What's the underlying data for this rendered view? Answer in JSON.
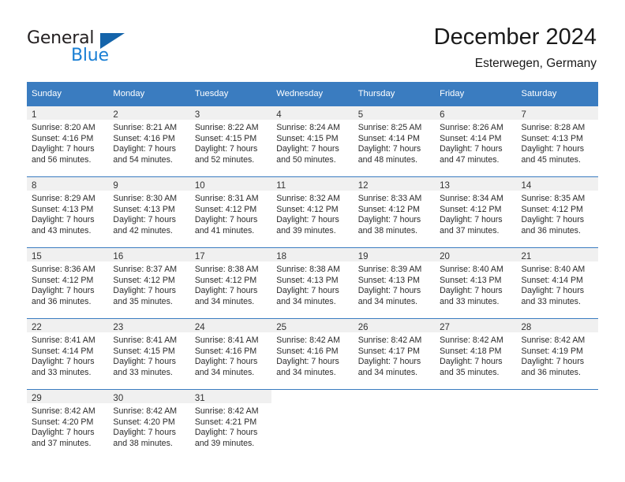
{
  "brand": {
    "line1": "General",
    "line2": "Blue",
    "triangle_color": "#1464aa"
  },
  "header": {
    "title": "December 2024",
    "subtitle": "Esterwegen, Germany"
  },
  "colors": {
    "header_blue": "#3a7cc0",
    "daynum_bg": "#f0f0f0",
    "brand_blue": "#1a7fd4"
  },
  "weekdays": [
    "Sunday",
    "Monday",
    "Tuesday",
    "Wednesday",
    "Thursday",
    "Friday",
    "Saturday"
  ],
  "weeks": [
    [
      {
        "day": "1",
        "sunrise": "Sunrise: 8:20 AM",
        "sunset": "Sunset: 4:16 PM",
        "daylight1": "Daylight: 7 hours",
        "daylight2": "and 56 minutes."
      },
      {
        "day": "2",
        "sunrise": "Sunrise: 8:21 AM",
        "sunset": "Sunset: 4:16 PM",
        "daylight1": "Daylight: 7 hours",
        "daylight2": "and 54 minutes."
      },
      {
        "day": "3",
        "sunrise": "Sunrise: 8:22 AM",
        "sunset": "Sunset: 4:15 PM",
        "daylight1": "Daylight: 7 hours",
        "daylight2": "and 52 minutes."
      },
      {
        "day": "4",
        "sunrise": "Sunrise: 8:24 AM",
        "sunset": "Sunset: 4:15 PM",
        "daylight1": "Daylight: 7 hours",
        "daylight2": "and 50 minutes."
      },
      {
        "day": "5",
        "sunrise": "Sunrise: 8:25 AM",
        "sunset": "Sunset: 4:14 PM",
        "daylight1": "Daylight: 7 hours",
        "daylight2": "and 48 minutes."
      },
      {
        "day": "6",
        "sunrise": "Sunrise: 8:26 AM",
        "sunset": "Sunset: 4:14 PM",
        "daylight1": "Daylight: 7 hours",
        "daylight2": "and 47 minutes."
      },
      {
        "day": "7",
        "sunrise": "Sunrise: 8:28 AM",
        "sunset": "Sunset: 4:13 PM",
        "daylight1": "Daylight: 7 hours",
        "daylight2": "and 45 minutes."
      }
    ],
    [
      {
        "day": "8",
        "sunrise": "Sunrise: 8:29 AM",
        "sunset": "Sunset: 4:13 PM",
        "daylight1": "Daylight: 7 hours",
        "daylight2": "and 43 minutes."
      },
      {
        "day": "9",
        "sunrise": "Sunrise: 8:30 AM",
        "sunset": "Sunset: 4:13 PM",
        "daylight1": "Daylight: 7 hours",
        "daylight2": "and 42 minutes."
      },
      {
        "day": "10",
        "sunrise": "Sunrise: 8:31 AM",
        "sunset": "Sunset: 4:12 PM",
        "daylight1": "Daylight: 7 hours",
        "daylight2": "and 41 minutes."
      },
      {
        "day": "11",
        "sunrise": "Sunrise: 8:32 AM",
        "sunset": "Sunset: 4:12 PM",
        "daylight1": "Daylight: 7 hours",
        "daylight2": "and 39 minutes."
      },
      {
        "day": "12",
        "sunrise": "Sunrise: 8:33 AM",
        "sunset": "Sunset: 4:12 PM",
        "daylight1": "Daylight: 7 hours",
        "daylight2": "and 38 minutes."
      },
      {
        "day": "13",
        "sunrise": "Sunrise: 8:34 AM",
        "sunset": "Sunset: 4:12 PM",
        "daylight1": "Daylight: 7 hours",
        "daylight2": "and 37 minutes."
      },
      {
        "day": "14",
        "sunrise": "Sunrise: 8:35 AM",
        "sunset": "Sunset: 4:12 PM",
        "daylight1": "Daylight: 7 hours",
        "daylight2": "and 36 minutes."
      }
    ],
    [
      {
        "day": "15",
        "sunrise": "Sunrise: 8:36 AM",
        "sunset": "Sunset: 4:12 PM",
        "daylight1": "Daylight: 7 hours",
        "daylight2": "and 36 minutes."
      },
      {
        "day": "16",
        "sunrise": "Sunrise: 8:37 AM",
        "sunset": "Sunset: 4:12 PM",
        "daylight1": "Daylight: 7 hours",
        "daylight2": "and 35 minutes."
      },
      {
        "day": "17",
        "sunrise": "Sunrise: 8:38 AM",
        "sunset": "Sunset: 4:12 PM",
        "daylight1": "Daylight: 7 hours",
        "daylight2": "and 34 minutes."
      },
      {
        "day": "18",
        "sunrise": "Sunrise: 8:38 AM",
        "sunset": "Sunset: 4:13 PM",
        "daylight1": "Daylight: 7 hours",
        "daylight2": "and 34 minutes."
      },
      {
        "day": "19",
        "sunrise": "Sunrise: 8:39 AM",
        "sunset": "Sunset: 4:13 PM",
        "daylight1": "Daylight: 7 hours",
        "daylight2": "and 34 minutes."
      },
      {
        "day": "20",
        "sunrise": "Sunrise: 8:40 AM",
        "sunset": "Sunset: 4:13 PM",
        "daylight1": "Daylight: 7 hours",
        "daylight2": "and 33 minutes."
      },
      {
        "day": "21",
        "sunrise": "Sunrise: 8:40 AM",
        "sunset": "Sunset: 4:14 PM",
        "daylight1": "Daylight: 7 hours",
        "daylight2": "and 33 minutes."
      }
    ],
    [
      {
        "day": "22",
        "sunrise": "Sunrise: 8:41 AM",
        "sunset": "Sunset: 4:14 PM",
        "daylight1": "Daylight: 7 hours",
        "daylight2": "and 33 minutes."
      },
      {
        "day": "23",
        "sunrise": "Sunrise: 8:41 AM",
        "sunset": "Sunset: 4:15 PM",
        "daylight1": "Daylight: 7 hours",
        "daylight2": "and 33 minutes."
      },
      {
        "day": "24",
        "sunrise": "Sunrise: 8:41 AM",
        "sunset": "Sunset: 4:16 PM",
        "daylight1": "Daylight: 7 hours",
        "daylight2": "and 34 minutes."
      },
      {
        "day": "25",
        "sunrise": "Sunrise: 8:42 AM",
        "sunset": "Sunset: 4:16 PM",
        "daylight1": "Daylight: 7 hours",
        "daylight2": "and 34 minutes."
      },
      {
        "day": "26",
        "sunrise": "Sunrise: 8:42 AM",
        "sunset": "Sunset: 4:17 PM",
        "daylight1": "Daylight: 7 hours",
        "daylight2": "and 34 minutes."
      },
      {
        "day": "27",
        "sunrise": "Sunrise: 8:42 AM",
        "sunset": "Sunset: 4:18 PM",
        "daylight1": "Daylight: 7 hours",
        "daylight2": "and 35 minutes."
      },
      {
        "day": "28",
        "sunrise": "Sunrise: 8:42 AM",
        "sunset": "Sunset: 4:19 PM",
        "daylight1": "Daylight: 7 hours",
        "daylight2": "and 36 minutes."
      }
    ],
    [
      {
        "day": "29",
        "sunrise": "Sunrise: 8:42 AM",
        "sunset": "Sunset: 4:20 PM",
        "daylight1": "Daylight: 7 hours",
        "daylight2": "and 37 minutes."
      },
      {
        "day": "30",
        "sunrise": "Sunrise: 8:42 AM",
        "sunset": "Sunset: 4:20 PM",
        "daylight1": "Daylight: 7 hours",
        "daylight2": "and 38 minutes."
      },
      {
        "day": "31",
        "sunrise": "Sunrise: 8:42 AM",
        "sunset": "Sunset: 4:21 PM",
        "daylight1": "Daylight: 7 hours",
        "daylight2": "and 39 minutes."
      },
      {
        "day": "",
        "sunrise": "",
        "sunset": "",
        "daylight1": "",
        "daylight2": ""
      },
      {
        "day": "",
        "sunrise": "",
        "sunset": "",
        "daylight1": "",
        "daylight2": ""
      },
      {
        "day": "",
        "sunrise": "",
        "sunset": "",
        "daylight1": "",
        "daylight2": ""
      },
      {
        "day": "",
        "sunrise": "",
        "sunset": "",
        "daylight1": "",
        "daylight2": ""
      }
    ]
  ]
}
